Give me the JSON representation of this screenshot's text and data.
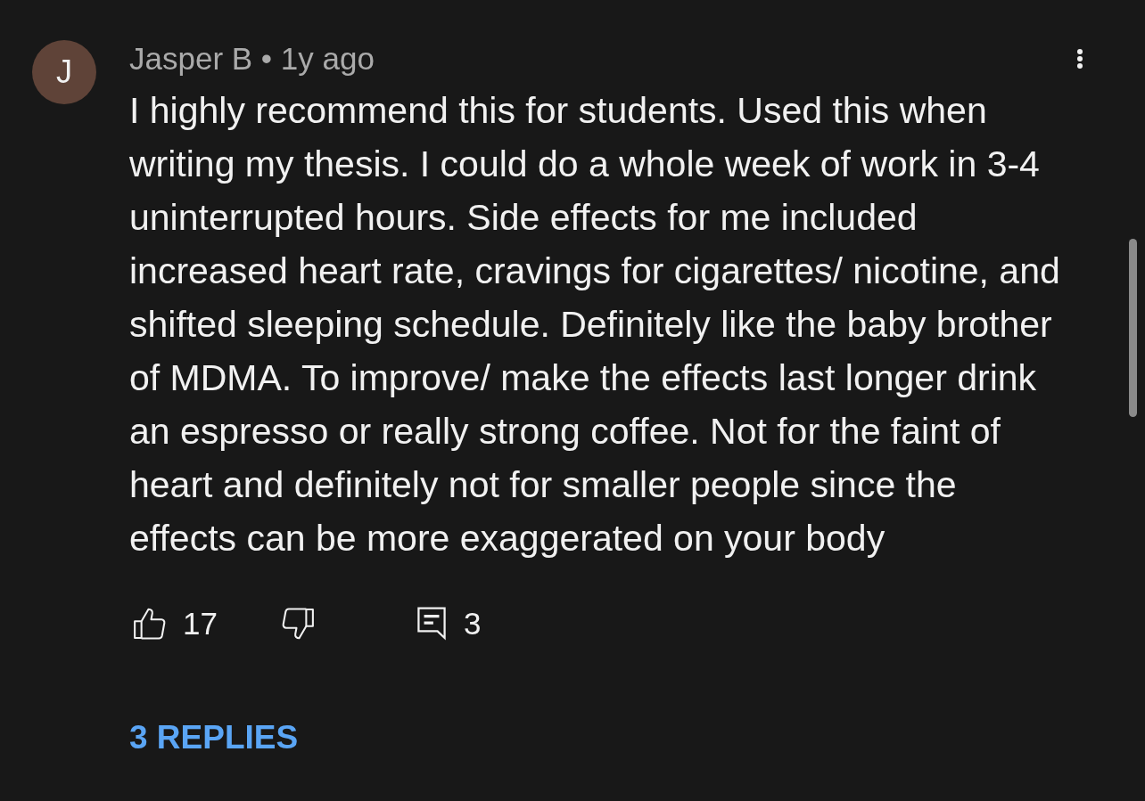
{
  "comment": {
    "avatar": {
      "initial": "J"
    },
    "byline": "Jasper B • 1y ago",
    "text": "I highly recommend this for students. Used this when\nwriting my thesis. I could do a whole week of work in 3-4\nuninterrupted hours. Side effects for me included\nincreased heart rate, cravings for cigarettes/ nicotine, and\nshifted sleeping schedule. Definitely like the baby brother\nof MDMA. To improve/ make the effects last longer drink\nan espresso or really strong coffee. Not for the faint of\nheart and definitely not for smaller people since the\neffects can be more exaggerated on your body",
    "likes": "17",
    "reply_count": "3",
    "replies_link": "3 REPLIES"
  }
}
